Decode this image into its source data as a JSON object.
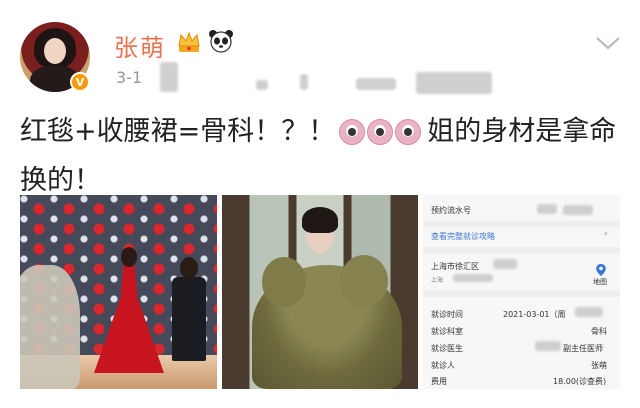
{
  "user": {
    "name": "张萌",
    "verified_badge": "V",
    "badges": [
      "crown-icon",
      "panda-icon"
    ]
  },
  "post": {
    "timestamp": "3-1",
    "text_part1": "红毯+收腰裙=骨科！？！",
    "text_part2": "姐的身材是拿命换的！",
    "emojis": [
      "shocked-face-icon",
      "shocked-face-icon",
      "shocked-face-icon"
    ]
  },
  "receipt": {
    "serial_label": "预约流水号",
    "details_link": "查看完整就诊攻略",
    "address_line1": "上海市徐汇区",
    "address_line2": "上海",
    "map_label": "地图",
    "rows": [
      {
        "label": "就诊时间",
        "value": "2021-03-01（周"
      },
      {
        "label": "就诊科室",
        "value": "骨科"
      },
      {
        "label": "就诊医生",
        "value": "副主任医师"
      },
      {
        "label": "就诊人",
        "value": "张萌"
      },
      {
        "label": "费用",
        "value": "18.00(诊查费)"
      }
    ]
  },
  "colors": {
    "username": "#eb7350",
    "verify": "#f59a00",
    "link": "#3b78d8"
  }
}
